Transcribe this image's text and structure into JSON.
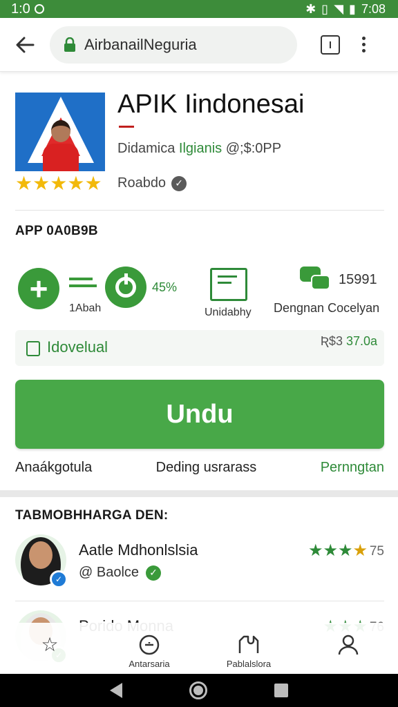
{
  "status_bar": {
    "time": "1:0",
    "clock": "7:08"
  },
  "browser": {
    "url": "AirbanailNeguria"
  },
  "app": {
    "title": "APIK Iindonesai",
    "developer_prefix": "Didamica ",
    "developer_highlight": "Ilgianis",
    "developer_suffix": " @;$:0PP",
    "rating_value": 4.5,
    "rating_label": "Roabdo"
  },
  "section_app_label": "APP 0A0B9B",
  "stats": {
    "first_label": "1Abah",
    "percent": "45%",
    "second_label": "Unidabhy",
    "third_value": "15991",
    "third_label": "Dengnan Cocelyan"
  },
  "price": {
    "label": "Idovelual",
    "value_prefix": "Ʀ$3 ",
    "value": "37.0a"
  },
  "install_label": "Undu",
  "meta": {
    "left": "Anaákgotula",
    "middle": "Deding usrarass",
    "right": "Pernngtan"
  },
  "reviews_heading": "TABMOBHHARGA DEN:",
  "reviews": [
    {
      "name": "Aatle Mdhonlslsia",
      "sub": "@ Baolce",
      "rating": 3.5,
      "score": "75"
    },
    {
      "name": "Porido Monna",
      "sub": "",
      "rating": 3,
      "score": "76"
    }
  ],
  "bottom_nav": [
    {
      "label": "",
      "icon": "star-icon"
    },
    {
      "label": "Antarsaria",
      "icon": "compass-icon"
    },
    {
      "label": "Pablalslora",
      "icon": "puzzle-icon"
    },
    {
      "label": "",
      "icon": "person-icon"
    }
  ],
  "colors": {
    "brand_green": "#3a9a3a",
    "status_green": "#3d8c3a",
    "install_green": "#48a848",
    "star_gold": "#f2b90a"
  }
}
